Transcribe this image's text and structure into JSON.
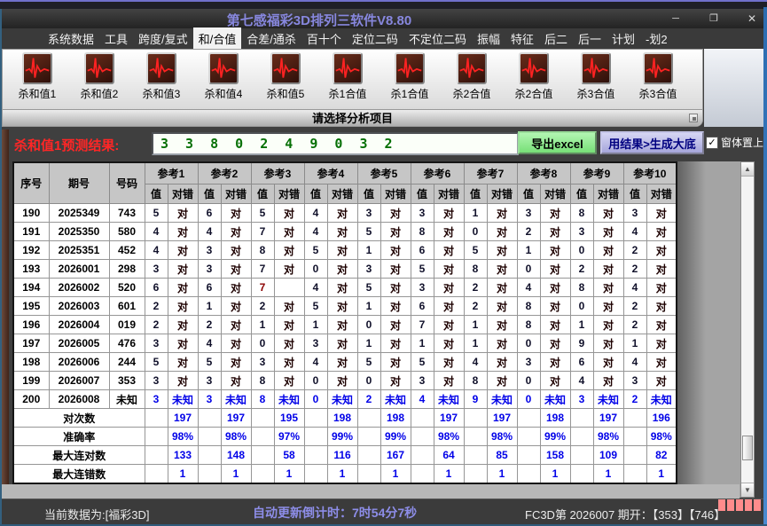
{
  "window": {
    "title": "第七感福彩3D排列三软件V8.80",
    "buttons": {
      "minimize": "─",
      "maximize": "❐",
      "close": "✕"
    }
  },
  "menu": {
    "items": [
      {
        "label": "系统数据"
      },
      {
        "label": "工具"
      },
      {
        "label": "跨度/复式"
      },
      {
        "label": "和/合值",
        "active": true
      },
      {
        "label": "合差/通杀"
      },
      {
        "label": "百十个"
      },
      {
        "label": "定位二码"
      },
      {
        "label": "不定位二码"
      },
      {
        "label": "振幅"
      },
      {
        "label": "特征"
      },
      {
        "label": "后二"
      },
      {
        "label": "后一"
      },
      {
        "label": "计划"
      },
      {
        "label": "-划2"
      }
    ]
  },
  "toolbar": {
    "icon": "ecg-waveform-icon",
    "buttons": [
      "杀和值1",
      "杀和值2",
      "杀和值3",
      "杀和值4",
      "杀和值5",
      "杀1合值",
      "杀1合值",
      "杀2合值",
      "杀2合值",
      "杀3合值",
      "杀3合值"
    ],
    "caption": "请选择分析项目"
  },
  "prediction": {
    "label": "杀和值1预测结果:",
    "value": "3 3 8 0 2 4 9 0 3 2",
    "export_button": "导出excel",
    "generate_button": "用结果>生成大底",
    "topmost": {
      "label": "窗体置上",
      "checked": true,
      "check_glyph": "✓"
    }
  },
  "table": {
    "columns": {
      "index": "序号",
      "period": "期号",
      "number": "号码"
    },
    "ref_labels": [
      "参考1",
      "参考2",
      "参考3",
      "参考4",
      "参考5",
      "参考6",
      "参考7",
      "参考8",
      "参考9",
      "参考10"
    ],
    "sub": {
      "value": "值",
      "result": "对错"
    },
    "legend": {
      "ok": "对",
      "unknown": "未知",
      "miss": ""
    },
    "rows": [
      {
        "index": "190",
        "period": "2025349",
        "number": "743",
        "values": [
          "5",
          "6",
          "5",
          "4",
          "3",
          "3",
          "1",
          "3",
          "8",
          "3"
        ]
      },
      {
        "index": "191",
        "period": "2025350",
        "number": "580",
        "values": [
          "4",
          "4",
          "7",
          "4",
          "5",
          "8",
          "0",
          "2",
          "3",
          "4"
        ]
      },
      {
        "index": "192",
        "period": "2025351",
        "number": "452",
        "values": [
          "4",
          "3",
          "8",
          "5",
          "1",
          "6",
          "5",
          "1",
          "0",
          "2"
        ]
      },
      {
        "index": "193",
        "period": "2026001",
        "number": "298",
        "values": [
          "3",
          "3",
          "7",
          "0",
          "3",
          "5",
          "8",
          "0",
          "2",
          "2"
        ]
      },
      {
        "index": "194",
        "period": "2026002",
        "number": "520",
        "values": [
          "6",
          "6",
          "7",
          "4",
          "5",
          "3",
          "2",
          "4",
          "8",
          "4"
        ],
        "miss": [
          2
        ]
      },
      {
        "index": "195",
        "period": "2026003",
        "number": "601",
        "values": [
          "2",
          "1",
          "2",
          "5",
          "1",
          "6",
          "2",
          "8",
          "0",
          "2"
        ]
      },
      {
        "index": "196",
        "period": "2026004",
        "number": "019",
        "values": [
          "2",
          "2",
          "1",
          "1",
          "0",
          "7",
          "1",
          "8",
          "1",
          "2"
        ]
      },
      {
        "index": "197",
        "period": "2026005",
        "number": "476",
        "values": [
          "3",
          "4",
          "0",
          "3",
          "1",
          "1",
          "1",
          "0",
          "9",
          "1"
        ]
      },
      {
        "index": "198",
        "period": "2026006",
        "number": "244",
        "values": [
          "5",
          "5",
          "3",
          "4",
          "5",
          "5",
          "4",
          "3",
          "6",
          "4"
        ]
      },
      {
        "index": "199",
        "period": "2026007",
        "number": "353",
        "values": [
          "3",
          "3",
          "8",
          "0",
          "0",
          "3",
          "8",
          "0",
          "4",
          "3"
        ]
      },
      {
        "index": "200",
        "period": "2026008",
        "number": "未知",
        "values": [
          "3",
          "3",
          "8",
          "0",
          "2",
          "4",
          "9",
          "0",
          "3",
          "2"
        ],
        "state": "unknown"
      }
    ],
    "summary": [
      {
        "label": "对次数",
        "values": [
          "197",
          "197",
          "195",
          "198",
          "198",
          "197",
          "197",
          "198",
          "197",
          "196"
        ]
      },
      {
        "label": "准确率",
        "values": [
          "98%",
          "98%",
          "97%",
          "99%",
          "99%",
          "98%",
          "98%",
          "99%",
          "98%",
          "98%"
        ]
      },
      {
        "label": "最大连对数",
        "values": [
          "133",
          "148",
          "58",
          "116",
          "167",
          "64",
          "85",
          "158",
          "109",
          "82"
        ]
      },
      {
        "label": "最大连错数",
        "values": [
          "1",
          "1",
          "1",
          "1",
          "1",
          "1",
          "1",
          "1",
          "1",
          "1"
        ],
        "selected_first": true
      }
    ]
  },
  "scrollbar": {
    "up": "▲",
    "down": "▼"
  },
  "status": {
    "left": "当前数据为:[福彩3D]",
    "countdown_label": "自动更新倒计时：",
    "countdown_value": "7时54分7秒",
    "right": "FC3D第 2026007 期开：【353】【746】",
    "indicator_count": 5
  },
  "colors": {
    "hit_bg": "#ff0000",
    "unknown_row_bg": "#ffb3fb",
    "summary_bg": "#7ffcfc",
    "selected_cell": "#00217b",
    "title_text": "#8787de",
    "countdown_text": "#8d8de8",
    "prediction_label": "#ff2626",
    "input_value_text": "#067006",
    "export_button_bg": "#8ef08e",
    "generate_button_bg": "#bcbcec",
    "indicator": "#ff8c8c"
  }
}
